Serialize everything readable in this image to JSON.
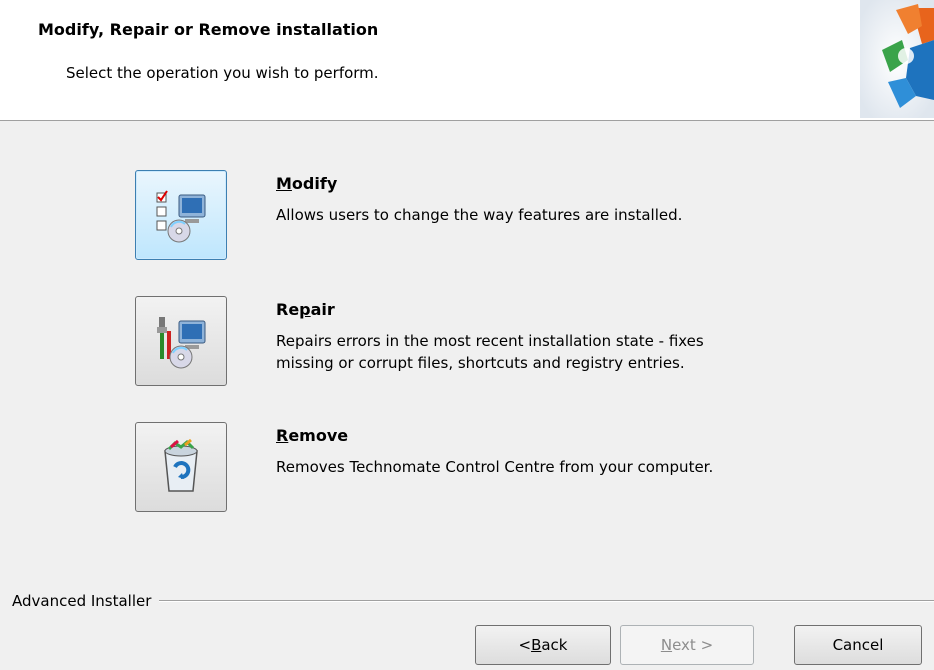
{
  "header": {
    "title": "Modify, Repair or Remove installation",
    "subtitle": "Select the operation you wish to perform."
  },
  "operations": [
    {
      "key": "modify",
      "title_access": "M",
      "title_rest": "odify",
      "description": "Allows users to change the way features are installed.",
      "icon": "modify-features-icon"
    },
    {
      "key": "repair",
      "title_pre": "Re",
      "title_access": "p",
      "title_rest": "air",
      "description_line1": "Repairs errors in the most recent installation state - fixes",
      "description_line2": "missing or corrupt files, shortcuts and registry entries.",
      "icon": "repair-tools-icon"
    },
    {
      "key": "remove",
      "title_access": "R",
      "title_rest": "emove",
      "description": "Removes Technomate Control Centre from your computer.",
      "icon": "recycle-bin-icon"
    }
  ],
  "footer": {
    "brand": "Advanced Installer"
  },
  "buttons": {
    "back_pre": "< ",
    "back_access": "B",
    "back_rest": "ack",
    "next_access": "N",
    "next_rest": "ext >",
    "cancel": "Cancel"
  },
  "colors": {
    "focus_border": "#3c7fb1",
    "focus_fill": "#bee6fd",
    "logo_orange": "#e8641c",
    "logo_blue": "#1e73be",
    "logo_green": "#3aa34a"
  }
}
